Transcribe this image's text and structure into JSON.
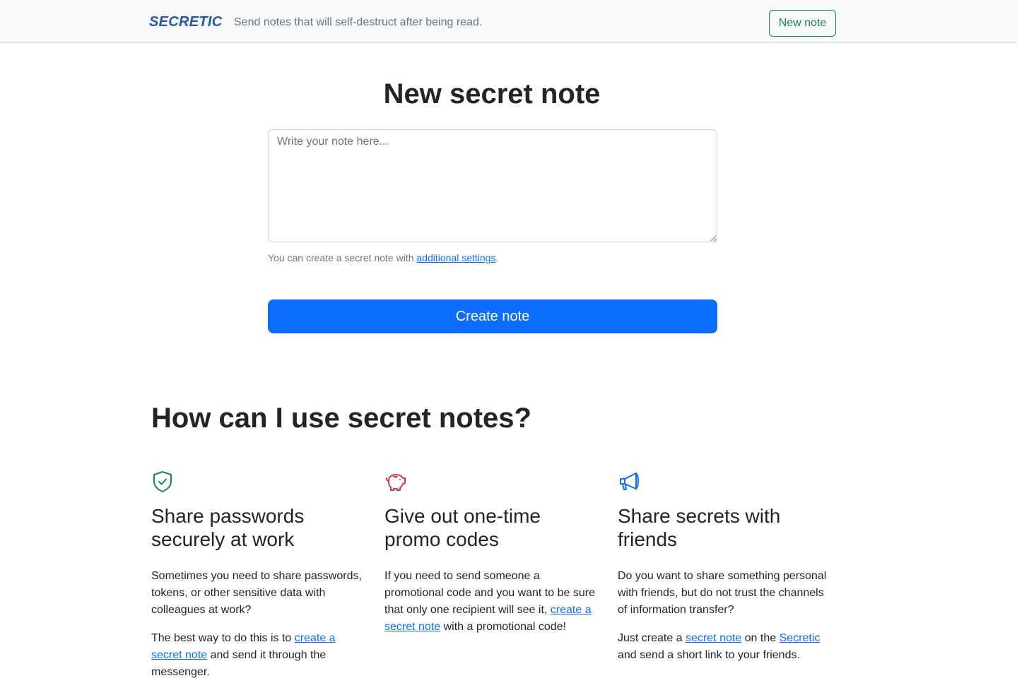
{
  "header": {
    "brand": "SECRETIC",
    "tagline": "Send notes that will self-destruct after being read.",
    "new_note_button": "New note"
  },
  "main": {
    "title": "New secret note",
    "note_placeholder": "Write your note here...",
    "settings_hint_prefix": "You can create a secret note with ",
    "settings_link": "additional settings",
    "settings_hint_suffix": ".",
    "create_button": "Create note"
  },
  "uses": {
    "title": "How can I use secret notes?",
    "items": [
      {
        "icon": "shield-check-icon",
        "title": "Share passwords securely at work",
        "p1": "Sometimes you need to share passwords, tokens, or other sensitive data with colleagues at work?",
        "p2_prefix": "The best way to do this is to ",
        "p2_link": "create a secret note",
        "p2_suffix": " and send it through the messenger."
      },
      {
        "icon": "piggy-bank-icon",
        "title": "Give out one-time promo codes",
        "p1_prefix": "If you need to send someone a promotional code and you want to be sure that only one recipient will see it, ",
        "p1_link": "create a secret note",
        "p1_suffix": " with a promotional code!"
      },
      {
        "icon": "megaphone-icon",
        "title": "Share secrets with friends",
        "p1": "Do you want to share something personal with friends, but do not trust the channels of information transfer?",
        "p2_prefix": "Just create a ",
        "p2_link1": "secret note",
        "p2_mid": " on the ",
        "p2_link2": "Secretic",
        "p2_suffix": " and send a short link to your friends."
      }
    ]
  },
  "colors": {
    "brand": "#2456b3",
    "primary": "#0d6efd",
    "success": "#198754",
    "danger": "#dc3545"
  }
}
